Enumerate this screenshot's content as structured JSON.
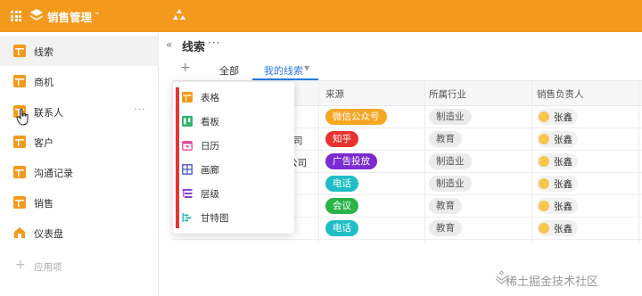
{
  "topbar": {
    "app_name": "销售管理",
    "color": "#f39a1c"
  },
  "sidebar": {
    "items": [
      {
        "label": "线索",
        "icon": "table-icon"
      },
      {
        "label": "商机",
        "icon": "table-icon"
      },
      {
        "label": "联系人",
        "icon": "table-icon",
        "more": "···"
      },
      {
        "label": "客户",
        "icon": "table-icon"
      },
      {
        "label": "沟通记录",
        "icon": "table-icon"
      },
      {
        "label": "销售",
        "icon": "table-icon"
      },
      {
        "label": "仪表盘",
        "icon": "home-icon"
      }
    ],
    "add_label": "应用项"
  },
  "main": {
    "title": "线索",
    "title_more": "···",
    "tabs": [
      {
        "label": "全部"
      },
      {
        "label": "我的线索"
      }
    ]
  },
  "view_menu": {
    "items": [
      {
        "label": "表格",
        "icon": "grid-view-icon",
        "color": "#f39a1c"
      },
      {
        "label": "看板",
        "icon": "kanban-icon",
        "color": "#2fb36b"
      },
      {
        "label": "日历",
        "icon": "calendar-icon",
        "color": "#e0459a"
      },
      {
        "label": "画廊",
        "icon": "gallery-icon",
        "color": "#3a4fc4"
      },
      {
        "label": "层级",
        "icon": "hierarchy-icon",
        "color": "#8e44c9"
      },
      {
        "label": "甘特图",
        "icon": "gantt-icon",
        "color": "#22b3b5"
      }
    ]
  },
  "table": {
    "headers": [
      "来源",
      "所属行业",
      "销售负责人"
    ],
    "rows": [
      {
        "fragment": "",
        "source": "微信公众号",
        "source_color": "#f5a623",
        "industry": "制造业",
        "owner": "张鑫"
      },
      {
        "fragment": "司",
        "source": "知乎",
        "source_color": "#e8322e",
        "industry": "教育",
        "owner": "张鑫"
      },
      {
        "fragment": "公司",
        "source": "广告投放",
        "source_color": "#7b2bd1",
        "industry": "制造业",
        "owner": "张鑫"
      },
      {
        "fragment": "",
        "source": "电话",
        "source_color": "#21bdc6",
        "industry": "制造业",
        "owner": "张鑫"
      },
      {
        "fragment": "",
        "source": "会议",
        "source_color": "#2bb34a",
        "industry": "教育",
        "owner": "张鑫"
      },
      {
        "fragment": "",
        "source": "电话",
        "source_color": "#21bdc6",
        "industry": "教育",
        "owner": "张鑫"
      }
    ]
  },
  "watermark": "稀土掘金技术社区"
}
